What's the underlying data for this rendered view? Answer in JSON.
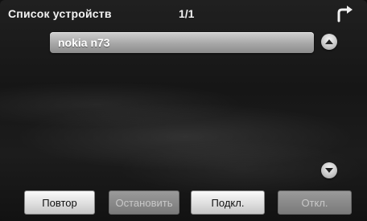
{
  "header": {
    "title": "Список устройств",
    "page_indicator": "1/1",
    "back_icon": "back-arrow-icon"
  },
  "devices": [
    {
      "name": "nokia n73",
      "selected": true
    }
  ],
  "scroll": {
    "up_icon": "scroll-up-icon",
    "down_icon": "scroll-down-icon"
  },
  "toolbar": {
    "retry_label": "Повтор",
    "stop_label": "Остановить",
    "connect_label": "Подкл.",
    "disconnect_label": "Откл."
  },
  "colors": {
    "background": "#1a1a1a",
    "button_enabled": "#e6e6e6",
    "button_disabled": "#8a8a8a",
    "text_light": "#f2f2f2"
  }
}
